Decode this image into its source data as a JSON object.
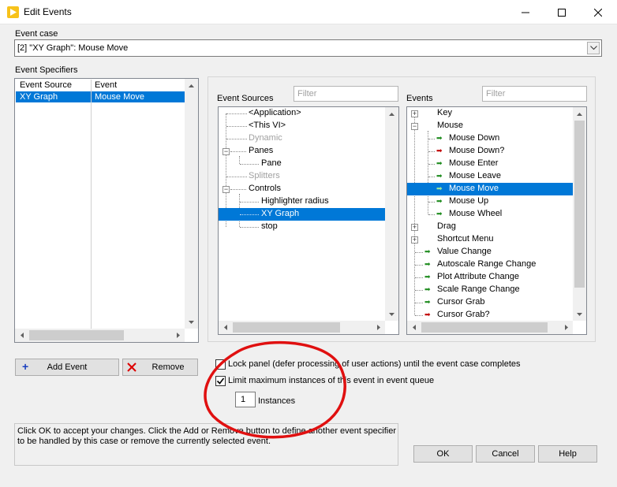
{
  "window": {
    "title": "Edit Events"
  },
  "event_case": {
    "label": "Event case",
    "value": "[2] \"XY Graph\": Mouse Move"
  },
  "event_specifiers": {
    "label": "Event Specifiers",
    "columns": [
      "Event Source",
      "Event"
    ],
    "rows": [
      {
        "source": "XY Graph",
        "event": "Mouse Move"
      }
    ]
  },
  "event_sources": {
    "label": "Event Sources",
    "filter_placeholder": "Filter",
    "items": [
      {
        "text": "<Application>",
        "state": "normal"
      },
      {
        "text": "<This VI>",
        "state": "normal"
      },
      {
        "text": "Dynamic",
        "state": "disabled"
      },
      {
        "text": "Panes",
        "state": "expanded"
      },
      {
        "text": "Pane",
        "state": "normal"
      },
      {
        "text": "Splitters",
        "state": "disabled"
      },
      {
        "text": "Controls",
        "state": "expanded"
      },
      {
        "text": "Highlighter radius",
        "state": "normal"
      },
      {
        "text": "XY Graph",
        "state": "selected"
      },
      {
        "text": "stop",
        "state": "normal"
      }
    ]
  },
  "events": {
    "label": "Events",
    "filter_placeholder": "Filter",
    "items": [
      {
        "text": "Key",
        "kind": "collapsed"
      },
      {
        "text": "Mouse",
        "kind": "expanded"
      },
      {
        "text": "Mouse Down",
        "kind": "notify"
      },
      {
        "text": "Mouse Down?",
        "kind": "filter"
      },
      {
        "text": "Mouse Enter",
        "kind": "notify"
      },
      {
        "text": "Mouse Leave",
        "kind": "notify"
      },
      {
        "text": "Mouse Move",
        "kind": "notify",
        "selected": true
      },
      {
        "text": "Mouse Up",
        "kind": "notify"
      },
      {
        "text": "Mouse Wheel",
        "kind": "notify"
      },
      {
        "text": "Drag",
        "kind": "collapsed"
      },
      {
        "text": "Shortcut Menu",
        "kind": "collapsed"
      },
      {
        "text": "Value Change",
        "kind": "notify"
      },
      {
        "text": "Autoscale Range Change",
        "kind": "notify"
      },
      {
        "text": "Plot Attribute Change",
        "kind": "notify"
      },
      {
        "text": "Scale Range Change",
        "kind": "notify"
      },
      {
        "text": "Cursor Grab",
        "kind": "notify"
      },
      {
        "text": "Cursor Grab?",
        "kind": "filter"
      }
    ]
  },
  "buttons": {
    "add_event": "Add Event",
    "remove": "Remove",
    "ok": "OK",
    "cancel": "Cancel",
    "help": "Help"
  },
  "options": {
    "lock_panel": {
      "label": "Lock panel (defer processing of user actions) until the event case completes",
      "checked": false
    },
    "limit_instances": {
      "label": "Limit maximum instances of this event in event queue",
      "checked": true
    },
    "instances_value": "1",
    "instances_label": "Instances"
  },
  "message": "Click OK to accept your changes.  Click the Add or Remove button to define another event specifier to be handled by this case or remove the currently selected event.",
  "colors": {
    "selection": "#0078d7",
    "annotation": "#e01010",
    "notify_arrow": "#1f8c1f",
    "filter_arrow": "#c00000"
  }
}
